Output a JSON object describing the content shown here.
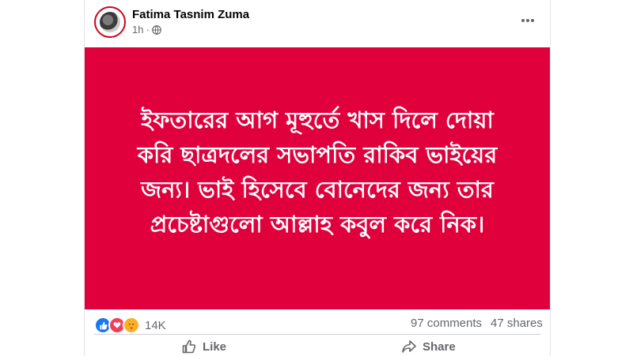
{
  "post": {
    "author": "Fatima Tasnim Zuma",
    "time": "1h",
    "privacy_icon": "globe-icon",
    "text": "ইফতারের আগ মূহুর্তে খাস দিলে দোয়া করি ছাত্রদলের সভাপতি রাকিব ভাইয়ের জন্য। ভাই হিসেবে বোনেদের জন্য তার প্রচেষ্টাগুলো আল্লাহ কবুল করে নিক।",
    "background_color": "#e0003c"
  },
  "stats": {
    "reaction_icons": [
      "like-icon",
      "love-icon",
      "care-icon"
    ],
    "reaction_count": "14K",
    "comments": "97 comments",
    "shares": "47 shares"
  },
  "actions": {
    "like_label": "Like",
    "share_label": "Share"
  }
}
